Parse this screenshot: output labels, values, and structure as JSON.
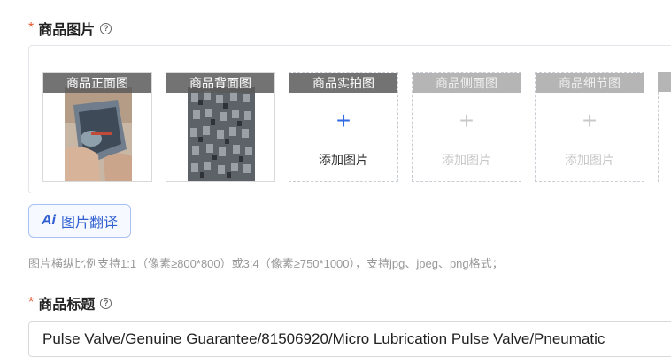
{
  "images_section": {
    "required_mark": "*",
    "title": "商品图片",
    "slots": [
      {
        "label": "商品正面图",
        "state": "filled",
        "add_text": ""
      },
      {
        "label": "商品背面图",
        "state": "filled",
        "add_text": ""
      },
      {
        "label": "商品实拍图",
        "state": "empty",
        "add_text": "添加图片"
      },
      {
        "label": "商品侧面图",
        "state": "disabled",
        "add_text": "添加图片"
      },
      {
        "label": "商品细节图",
        "state": "disabled",
        "add_text": "添加图片"
      }
    ],
    "ai_translate_label": "图片翻译",
    "ai_mark": "Ai",
    "hint": "图片横纵比例支持1:1（像素≥800*800）或3:4（像素≥750*1000），支持jpg、jpeg、png格式；"
  },
  "title_section": {
    "required_mark": "*",
    "title": "商品标题",
    "value": "Pulse Valve/Genuine Guarantee/81506920/Micro Lubrication Pulse Valve/Pneumatic"
  },
  "colors": {
    "required": "#e4572e",
    "accent": "#2f6ae3",
    "border": "#d9d9d9",
    "hint": "#999999"
  }
}
